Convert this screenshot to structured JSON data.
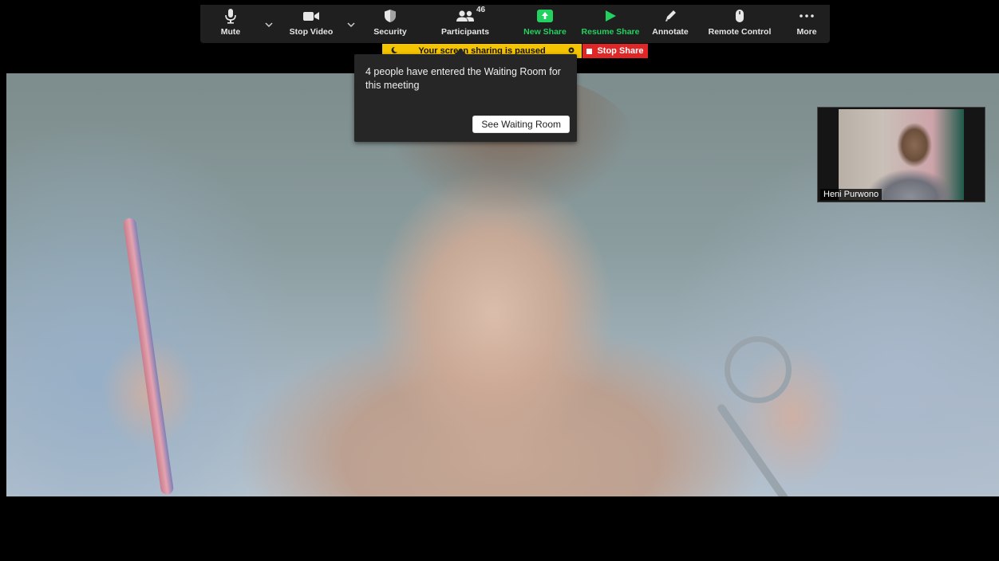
{
  "toolbar": {
    "mute_label": "Mute",
    "stop_video_label": "Stop Video",
    "security_label": "Security",
    "participants_label": "Participants",
    "participants_count": "46",
    "new_share_label": "New Share",
    "resume_share_label": "Resume Share",
    "annotate_label": "Annotate",
    "remote_control_label": "Remote Control",
    "more_label": "More"
  },
  "share_banner": {
    "status_text": "Your screen sharing is paused",
    "stop_share_label": "Stop Share"
  },
  "waiting_room_popup": {
    "message": "4 people have entered the Waiting Room for this meeting",
    "button_label": "See Waiting Room"
  },
  "self_view": {
    "name": "Heni Purwono"
  },
  "colors": {
    "toolbar_bg": "#1f1f1f",
    "share_green": "#23d160",
    "paused_yellow": "#f5c400",
    "stop_red": "#e02727"
  },
  "icons": [
    "microphone-icon",
    "video-camera-icon",
    "shield-icon",
    "participants-icon",
    "share-up-arrow-icon",
    "play-icon",
    "pencil-icon",
    "mouse-icon",
    "more-dots-icon",
    "chevron-down-icon"
  ]
}
